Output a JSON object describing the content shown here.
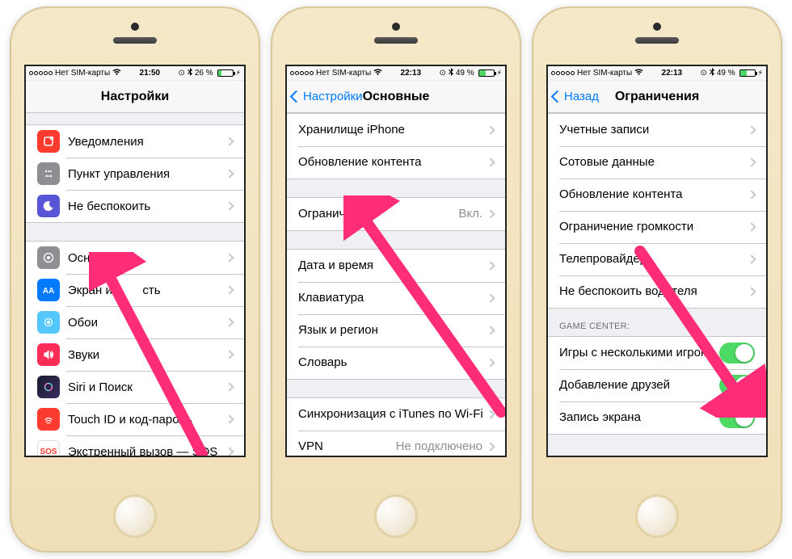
{
  "status": {
    "carrier": "Нет SIM-карты",
    "time1": "21:50",
    "time2": "22:13",
    "time3": "22:13",
    "bt_pct1": "26 %",
    "bt_pct2": "49 %",
    "bt_pct3": "49 %"
  },
  "phone1": {
    "title": "Настройки",
    "rows": {
      "notifications": "Уведомления",
      "control_center": "Пункт управления",
      "dnd": "Не беспокоить",
      "general": "Основные",
      "display": "Экран и",
      "display_tail": "сть",
      "wallpaper": "Обои",
      "sounds": "Звуки",
      "siri": "Siri и Поиск",
      "touchid": "Touch ID и код-пароль",
      "sos": "Экстренный вызов — SOS"
    }
  },
  "phone2": {
    "back": "Настройки",
    "title": "Основные",
    "rows": {
      "storage": "Хранилище iPhone",
      "bg_refresh": "Обновление контента",
      "restrictions": "Ограничения",
      "restrictions_state": "Вкл.",
      "datetime": "Дата и время",
      "keyboard": "Клавиатура",
      "language": "Язык и регион",
      "dictionary": "Словарь",
      "itunes_wifi": "Синхронизация с iTunes по Wi-Fi",
      "vpn": "VPN",
      "vpn_state": "Не подключено"
    }
  },
  "phone3": {
    "back": "Назад",
    "title": "Ограничения",
    "rows": {
      "accounts": "Учетные записи",
      "cellular": "Сотовые данные",
      "bg_refresh": "Обновление контента",
      "volume": "Ограничение громкости",
      "tv_provider": "Телепровайдер",
      "dnd_driving": "Не беспокоить водителя"
    },
    "gc_header": "GAME CENTER:",
    "gc": {
      "multiplayer": "Игры с несколькими игрока...",
      "add_friends": "Добавление друзей",
      "screen_record": "Запись экрана"
    }
  },
  "colors": {
    "accent": "#007aff",
    "toggle_on": "#4cd964",
    "arrow": "#ff2d78"
  }
}
